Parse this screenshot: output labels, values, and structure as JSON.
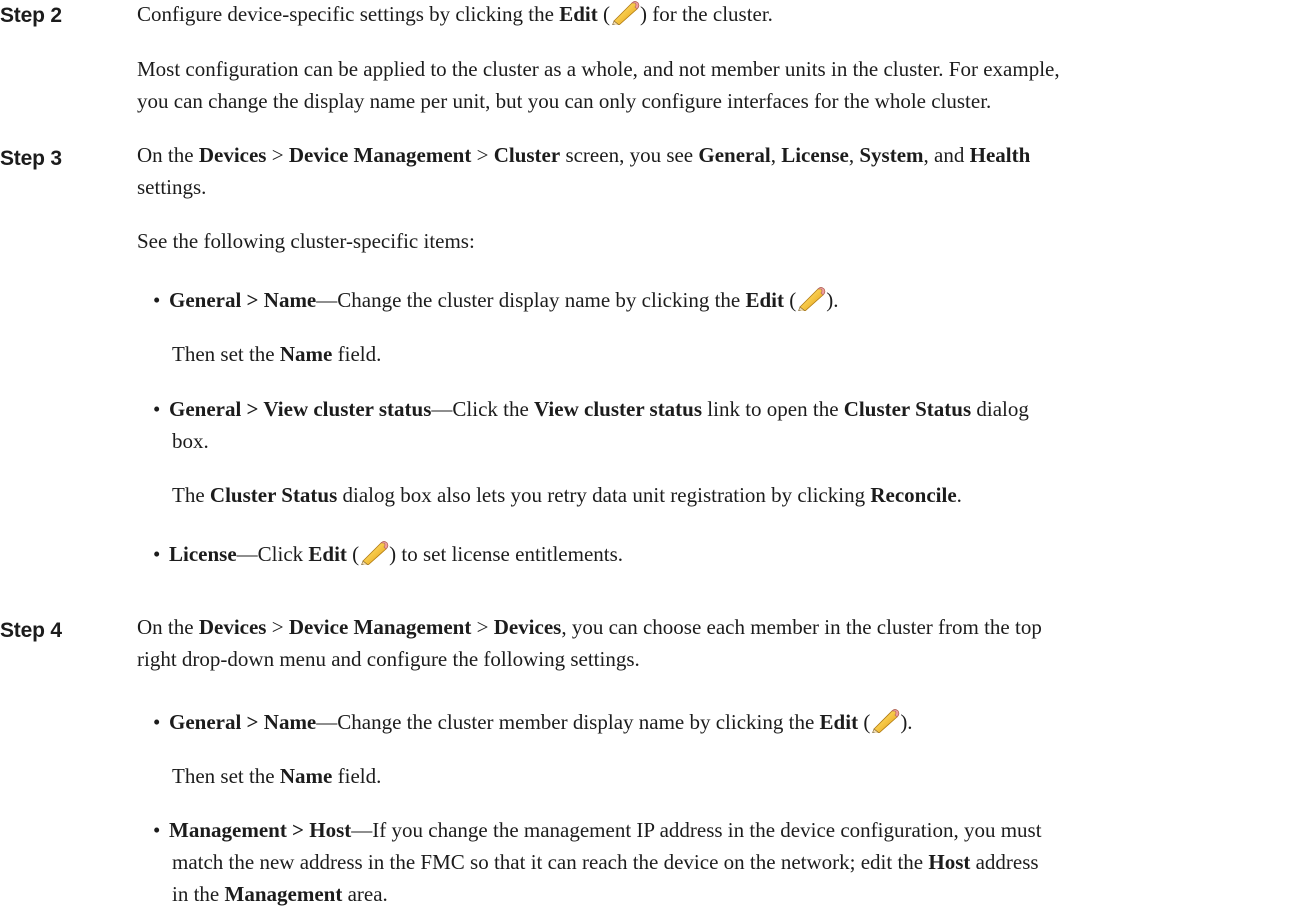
{
  "steps": [
    {
      "label": "Step 2",
      "p1": {
        "t1": "Configure device-specific settings by clicking the ",
        "b1": "Edit",
        "t2": " (",
        "t3": ") for the cluster."
      },
      "p2": {
        "l1": "Most configuration can be applied to the cluster as a whole, and not member units in the cluster. For example,",
        "l2": "you can change the display name per unit, but you can only configure interfaces for the whole cluster."
      }
    },
    {
      "label": "Step 3",
      "p1": {
        "t1": "On the ",
        "b1": "Devices",
        "t2": " > ",
        "b2": "Device Management",
        "t3": " > ",
        "b3": "Cluster",
        "t4": " screen, you see ",
        "b4": "General",
        "t5": ", ",
        "b5": "License",
        "t6": ", ",
        "b6": "System",
        "t7": ", and ",
        "b7": "Health",
        "t8": "settings."
      },
      "p2": "See the following cluster-specific items:",
      "bullets": [
        {
          "b1": "General > Name",
          "t1": "—Change the cluster display name by clicking the ",
          "b2": "Edit",
          "t2": " (",
          "t3": ").",
          "sub": {
            "t1": "Then set the ",
            "b1": "Name",
            "t2": " field."
          }
        },
        {
          "b1": "General > View cluster status",
          "t1": "—Click the ",
          "b2": "View cluster status",
          "t2": " link to open the ",
          "b3": "Cluster Status",
          "t3": " dialog",
          "t4": "box.",
          "sub": {
            "t1": "The ",
            "b1": "Cluster Status",
            "t2": " dialog box also lets you retry data unit registration by clicking ",
            "b2": "Reconcile",
            "t3": "."
          }
        },
        {
          "b1": "License",
          "t1": "—Click ",
          "b2": "Edit",
          "t2": " (",
          "t3": ") to set license entitlements."
        }
      ]
    },
    {
      "label": "Step 4",
      "p1": {
        "t1": "On the ",
        "b1": "Devices",
        "t2": " > ",
        "b2": "Device Management",
        "t3": " > ",
        "b3": "Devices",
        "t4": ", you can choose each member in the cluster from the top",
        "l2": "right drop-down menu and configure the following settings."
      },
      "bullets": [
        {
          "b1": "General > Name",
          "t1": "—Change the cluster member display name by clicking the ",
          "b2": "Edit",
          "t2": " (",
          "t3": ").",
          "sub": {
            "t1": "Then set the ",
            "b1": "Name",
            "t2": " field."
          }
        },
        {
          "b1": "Management > Host",
          "t1": "—If you change the management IP address in the device configuration, you must",
          "l2": "match the new address in the FMC so that it can reach the device on the network; edit the ",
          "b2": "Host",
          "t2": " address",
          "l3a": "in the ",
          "b3": "Management",
          "l3b": " area."
        }
      ]
    }
  ],
  "icons": {
    "edit": "pencil-edit-icon",
    "bullet": "•"
  }
}
